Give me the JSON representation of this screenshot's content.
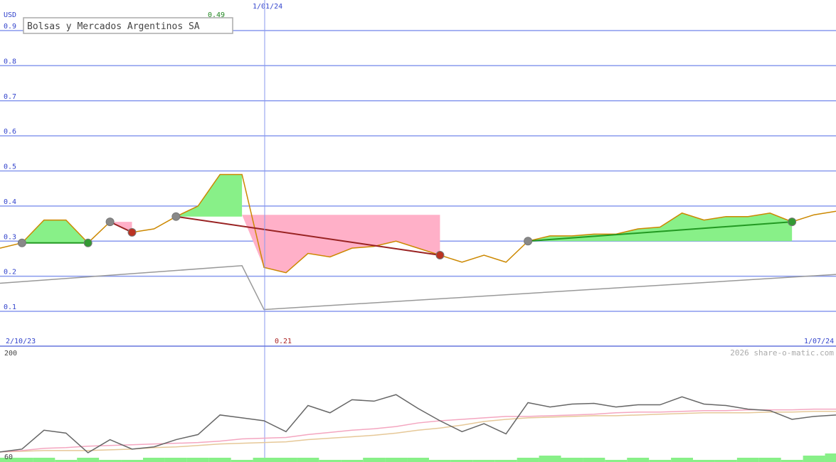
{
  "colors": {
    "grid": "#8899ee",
    "price_line": "#cc8800",
    "trend_line": "#999999",
    "gain_fill": "#88f088",
    "loss_fill": "#ffb0c8",
    "buy_dot": "#339933",
    "sell_dot": "#bb3322",
    "neutral_dot": "#888888",
    "gain_trade_line": "#229922",
    "loss_trade_line": "#992222",
    "osc_dark": "#666666",
    "osc_pink": "#f4a6c0",
    "osc_tan": "#e6c898",
    "volume": "#88f088"
  },
  "chart_data": {
    "type": "line",
    "title": "Bolsas y Mercados Argentinos SA",
    "ylabel": "USD",
    "ylim": [
      0.07,
      0.97
    ],
    "yticks": [
      "0.1",
      "0.2",
      "0.3",
      "0.4",
      "0.5",
      "0.6",
      "0.7",
      "0.8",
      "0.9"
    ],
    "x_labels": {
      "start": "2/10/23",
      "marker": "1/01/24",
      "end": "1/07/24"
    },
    "max_label": "0.49",
    "min_label": "0.21",
    "credit": "2026 share-o-matic.com",
    "price": [
      {
        "i": 0,
        "y": 0.28
      },
      {
        "i": 1,
        "y": 0.295
      },
      {
        "i": 2,
        "y": 0.36
      },
      {
        "i": 3,
        "y": 0.36
      },
      {
        "i": 4,
        "y": 0.295
      },
      {
        "i": 5,
        "y": 0.355
      },
      {
        "i": 6,
        "y": 0.325
      },
      {
        "i": 7,
        "y": 0.335
      },
      {
        "i": 8,
        "y": 0.37
      },
      {
        "i": 9,
        "y": 0.4
      },
      {
        "i": 10,
        "y": 0.49
      },
      {
        "i": 11,
        "y": 0.49
      },
      {
        "i": 12,
        "y": 0.225
      },
      {
        "i": 13,
        "y": 0.21
      },
      {
        "i": 14,
        "y": 0.265
      },
      {
        "i": 15,
        "y": 0.255
      },
      {
        "i": 16,
        "y": 0.28
      },
      {
        "i": 17,
        "y": 0.285
      },
      {
        "i": 18,
        "y": 0.3
      },
      {
        "i": 19,
        "y": 0.28
      },
      {
        "i": 20,
        "y": 0.26
      },
      {
        "i": 21,
        "y": 0.24
      },
      {
        "i": 22,
        "y": 0.26
      },
      {
        "i": 23,
        "y": 0.24
      },
      {
        "i": 24,
        "y": 0.3
      },
      {
        "i": 25,
        "y": 0.315
      },
      {
        "i": 26,
        "y": 0.315
      },
      {
        "i": 27,
        "y": 0.32
      },
      {
        "i": 28,
        "y": 0.32
      },
      {
        "i": 29,
        "y": 0.335
      },
      {
        "i": 30,
        "y": 0.34
      },
      {
        "i": 31,
        "y": 0.38
      },
      {
        "i": 32,
        "y": 0.36
      },
      {
        "i": 33,
        "y": 0.37
      },
      {
        "i": 34,
        "y": 0.37
      },
      {
        "i": 35,
        "y": 0.38
      },
      {
        "i": 36,
        "y": 0.355
      },
      {
        "i": 37,
        "y": 0.375
      },
      {
        "i": 38,
        "y": 0.385
      }
    ],
    "trend": [
      {
        "i": 0,
        "y": 0.18
      },
      {
        "i": 11,
        "y": 0.23
      },
      {
        "i": 12,
        "y": 0.105
      },
      {
        "i": 38,
        "y": 0.205
      }
    ],
    "gain_zones": [
      {
        "from": 1,
        "to": 4,
        "base": 0.295
      },
      {
        "from": 8,
        "to": 11,
        "base": 0.37
      },
      {
        "from": 24,
        "to": 36,
        "base": 0.3
      }
    ],
    "loss_zones": [
      {
        "from": 5,
        "to": 6,
        "top": 0.355
      },
      {
        "from": 11,
        "to": 20,
        "top": 0.375
      }
    ],
    "trades": [
      {
        "from": 1,
        "to": 4,
        "y1": 0.295,
        "y2": 0.295,
        "result": "gain"
      },
      {
        "from": 5,
        "to": 6,
        "y1": 0.355,
        "y2": 0.325,
        "result": "loss"
      },
      {
        "from": 8,
        "to": 20,
        "y1": 0.37,
        "y2": 0.26,
        "result": "loss"
      },
      {
        "from": 24,
        "to": 36,
        "y1": 0.3,
        "y2": 0.355,
        "result": "gain"
      }
    ],
    "markers": [
      {
        "i": 1,
        "y": 0.295,
        "kind": "neutral"
      },
      {
        "i": 4,
        "y": 0.295,
        "kind": "buy"
      },
      {
        "i": 5,
        "y": 0.355,
        "kind": "neutral"
      },
      {
        "i": 6,
        "y": 0.325,
        "kind": "sell"
      },
      {
        "i": 8,
        "y": 0.37,
        "kind": "neutral"
      },
      {
        "i": 20,
        "y": 0.26,
        "kind": "sell"
      },
      {
        "i": 24,
        "y": 0.3,
        "kind": "neutral"
      },
      {
        "i": 36,
        "y": 0.355,
        "kind": "buy"
      }
    ],
    "oscillator": {
      "top_label": "200",
      "bottom_label": "60",
      "ylim": [
        60,
        200
      ],
      "main": [
        64,
        68,
        94,
        90,
        63,
        81,
        68,
        71,
        81,
        88,
        115,
        111,
        107,
        92,
        128,
        118,
        136,
        134,
        143,
        124,
        107,
        92,
        103,
        89,
        132,
        126,
        130,
        131,
        126,
        129,
        129,
        140,
        130,
        128,
        123,
        121,
        109,
        113,
        115
      ],
      "pink": [
        64,
        66,
        69,
        70,
        72,
        73,
        74,
        75,
        76,
        77,
        79,
        82,
        83,
        84,
        88,
        91,
        94,
        96,
        99,
        104,
        107,
        109,
        111,
        113,
        113,
        114,
        115,
        116,
        118,
        119,
        119,
        120,
        121,
        121,
        122,
        122,
        122,
        123,
        123
      ],
      "tan": [
        64,
        65,
        66,
        66,
        66,
        67,
        68,
        70,
        71,
        73,
        75,
        76,
        77,
        78,
        81,
        83,
        85,
        87,
        90,
        94,
        97,
        101,
        106,
        109,
        111,
        112,
        113,
        114,
        114,
        115,
        116,
        117,
        118,
        118,
        118,
        119,
        119,
        120,
        120
      ],
      "volume": [
        2.0,
        2.0,
        2.0,
        1.0,
        2.0,
        1.0,
        1.0,
        2.0,
        2.0,
        2.0,
        2.0,
        1.0,
        2.0,
        2.0,
        2.0,
        1.0,
        1.0,
        2.0,
        2.0,
        2.0,
        1.0,
        1.0,
        1.0,
        1.0,
        2.0,
        3.0,
        2.0,
        2.0,
        1.0,
        2.0,
        1.0,
        2.0,
        1.0,
        1.0,
        2.0,
        2.0,
        1.0,
        3.0,
        4.0
      ]
    }
  }
}
